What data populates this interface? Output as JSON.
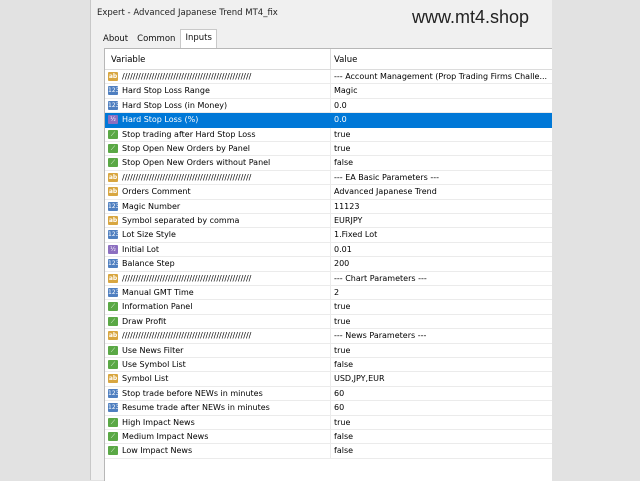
{
  "window": {
    "title": "Expert - Advanced Japanese Trend MT4_fix",
    "watermark": "www.mt4.shop"
  },
  "tabs": [
    {
      "label": "About",
      "active": false
    },
    {
      "label": "Common",
      "active": false
    },
    {
      "label": "Inputs",
      "active": true
    }
  ],
  "table": {
    "headers": {
      "variable": "Variable",
      "value": "Value"
    },
    "rows": [
      {
        "type": "ab",
        "variable": "////////////////////////////////////////////////",
        "value": "--- Account Management (Prop Trading Firms Challe..."
      },
      {
        "type": "num",
        "variable": "Hard Stop Loss Range",
        "value": "Magic"
      },
      {
        "type": "num",
        "variable": "Hard Stop Loss (in Money)",
        "value": "0.0"
      },
      {
        "type": "dbl",
        "variable": "Hard Stop Loss (%)",
        "value": "0.0",
        "selected": true
      },
      {
        "type": "bool",
        "variable": "Stop trading after Hard Stop Loss",
        "value": "true"
      },
      {
        "type": "bool",
        "variable": "Stop Open New Orders by Panel",
        "value": "true"
      },
      {
        "type": "bool",
        "variable": "Stop Open New Orders without Panel",
        "value": "false"
      },
      {
        "type": "ab",
        "variable": "////////////////////////////////////////////////",
        "value": "--- EA Basic Parameters ---"
      },
      {
        "type": "ab",
        "variable": "Orders Comment",
        "value": "Advanced Japanese Trend"
      },
      {
        "type": "num",
        "variable": "Magic Number",
        "value": "11123"
      },
      {
        "type": "ab",
        "variable": "Symbol separated by comma",
        "value": "EURJPY"
      },
      {
        "type": "num",
        "variable": "Lot Size Style",
        "value": "1.Fixed Lot"
      },
      {
        "type": "dbl",
        "variable": "Initial Lot",
        "value": "0.01"
      },
      {
        "type": "num",
        "variable": "Balance Step",
        "value": "200"
      },
      {
        "type": "ab",
        "variable": "////////////////////////////////////////////////",
        "value": "--- Chart Parameters ---"
      },
      {
        "type": "num",
        "variable": "Manual GMT Time",
        "value": "2"
      },
      {
        "type": "bool",
        "variable": "Information Panel",
        "value": "true"
      },
      {
        "type": "bool",
        "variable": "Draw Profit",
        "value": "true"
      },
      {
        "type": "ab",
        "variable": "////////////////////////////////////////////////",
        "value": "--- News Parameters ---"
      },
      {
        "type": "bool",
        "variable": "Use News Filter",
        "value": "true"
      },
      {
        "type": "bool",
        "variable": "Use Symbol List",
        "value": "false"
      },
      {
        "type": "ab",
        "variable": "Symbol List",
        "value": "USD,JPY,EUR"
      },
      {
        "type": "num",
        "variable": "Stop trade before NEWs in minutes",
        "value": "60"
      },
      {
        "type": "num",
        "variable": "Resume trade after NEWs in minutes",
        "value": "60"
      },
      {
        "type": "bool",
        "variable": "High Impact News",
        "value": "true"
      },
      {
        "type": "bool",
        "variable": "Medium Impact News",
        "value": "false"
      },
      {
        "type": "bool",
        "variable": "Low Impact News",
        "value": "false"
      }
    ]
  },
  "icons": {
    "ab": "string-param-icon",
    "num": "integer-param-icon",
    "dbl": "double-param-icon",
    "bool": "boolean-param-icon"
  },
  "colors": {
    "selection": "#0078d7",
    "string_icon": "#d8a640",
    "integer_icon": "#4f7fc0",
    "bool_icon": "#5aa845",
    "double_icon": "#8c6fc0"
  }
}
